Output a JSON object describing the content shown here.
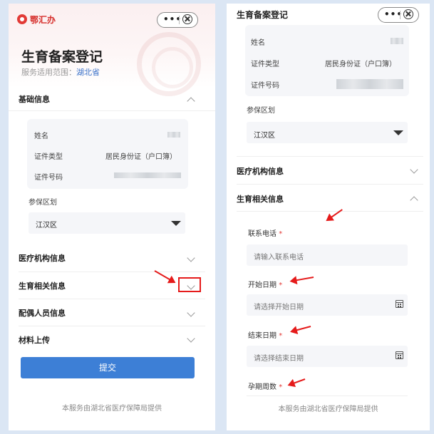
{
  "left": {
    "logo_text": "鄂汇办",
    "capsule": {
      "more": "•••"
    },
    "page_title": "生育备案登记",
    "scope_label": "服务适用范围：",
    "scope_value": "湖北省",
    "basic_info": {
      "title": "基础信息",
      "name_label": "姓名",
      "id_type_label": "证件类型",
      "id_type_value": "居民身份证（户口簿）",
      "id_no_label": "证件号码",
      "insured_area_label": "参保区划",
      "insured_area_value": "江汉区"
    },
    "sections": [
      "医疗机构信息",
      "生育相关信息",
      "配偶人员信息",
      "材料上传"
    ],
    "submit_label": "提交",
    "footer": "本服务由湖北省医疗保障局提供"
  },
  "right": {
    "page_title": "生育备案登记",
    "capsule": {
      "more": "•••"
    },
    "basic_info": {
      "name_label": "姓名",
      "id_type_label": "证件类型",
      "id_type_value": "居民身份证（户口簿）",
      "id_no_label": "证件号码",
      "insured_area_label": "参保区划",
      "insured_area_value": "江汉区"
    },
    "sections": [
      "医疗机构信息",
      "生育相关信息"
    ],
    "fields": [
      {
        "label": "联系电话",
        "required": "*",
        "placeholder": "请输入联系电话"
      },
      {
        "label": "开始日期",
        "required": "*",
        "placeholder": "请选择开始日期"
      },
      {
        "label": "结束日期",
        "required": "*",
        "placeholder": "请选择结束日期"
      },
      {
        "label": "孕期周数",
        "required": "*"
      }
    ],
    "footer": "本服务由湖北省医疗保障局提供"
  },
  "colors": {
    "accent": "#3d7fd6",
    "annotation": "#e51b1b",
    "brand": "#d62d2a"
  }
}
